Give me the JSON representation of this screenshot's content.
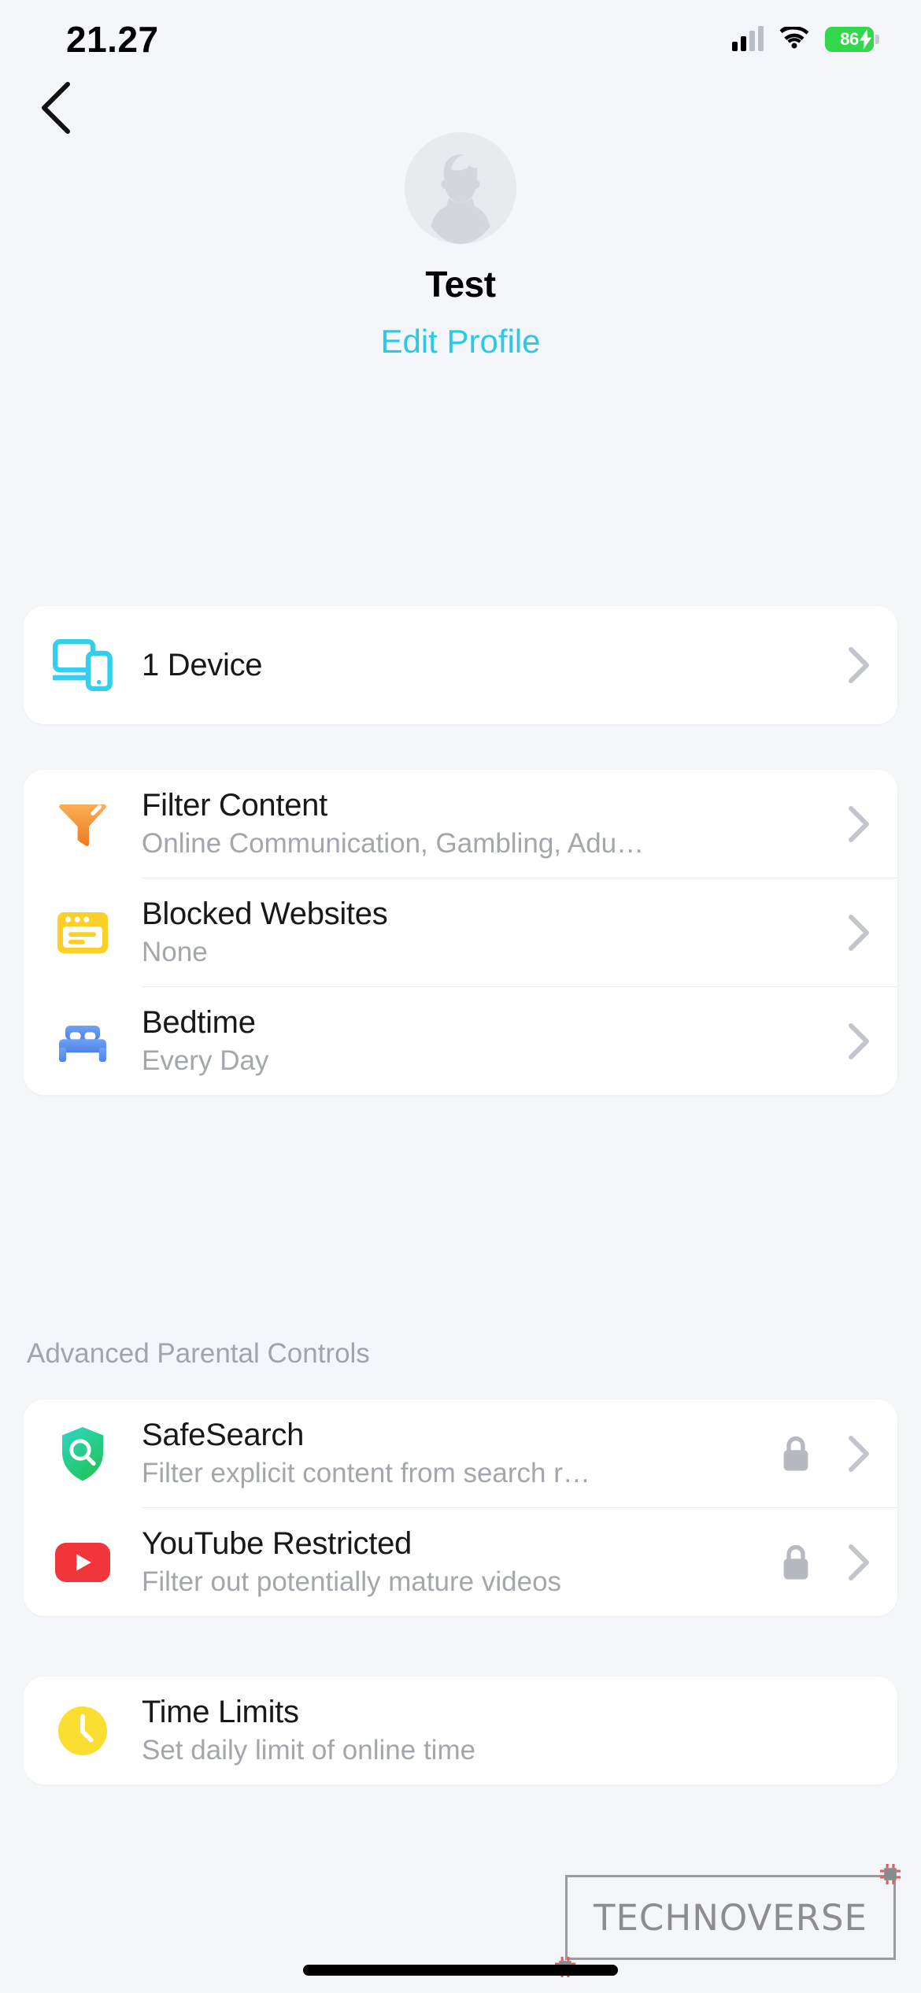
{
  "status_bar": {
    "time": "21.27",
    "battery_percent": "86",
    "battery_color": "#32D74B",
    "signal_icon": "cellular-signal-icon",
    "wifi_icon": "wifi-icon",
    "charging_icon": "charging-bolt-icon"
  },
  "nav": {
    "back_icon": "chevron-left-icon"
  },
  "profile": {
    "avatar_icon": "person-placeholder-avatar",
    "name": "Test",
    "edit_label": "Edit Profile",
    "accent_color": "#2EC8E6"
  },
  "device_card": {
    "icon": "devices-icon",
    "icon_color": "#35CFEE",
    "label": "1 Device",
    "chevron": "chevron-right-icon"
  },
  "filters_card": {
    "items": [
      {
        "icon": "funnel-filter-icon",
        "icon_color": "#F59331",
        "title": "Filter Content",
        "subtitle": "Online Communication, Gambling, Adu…"
      },
      {
        "icon": "browser-window-icon",
        "icon_color": "#FAD029",
        "title": "Blocked Websites",
        "subtitle": "None"
      },
      {
        "icon": "bed-icon",
        "icon_color": "#5B8FEF",
        "title": "Bedtime",
        "subtitle": "Every Day"
      }
    ]
  },
  "advanced_section": {
    "header": "Advanced Parental Controls",
    "items": [
      {
        "icon": "shield-search-icon",
        "icon_color": "#25D0A5",
        "title": "SafeSearch",
        "subtitle": "Filter explicit content from search r…",
        "locked": true,
        "lock_icon": "lock-icon"
      },
      {
        "icon": "youtube-icon",
        "icon_color": "#F0353B",
        "title": "YouTube Restricted",
        "subtitle": "Filter out potentially mature videos",
        "locked": true,
        "lock_icon": "lock-icon"
      }
    ]
  },
  "time_card": {
    "items": [
      {
        "icon": "clock-icon",
        "icon_color": "#FBDE32",
        "title": "Time Limits",
        "subtitle": "Set daily limit of online time"
      }
    ]
  },
  "watermark": {
    "text": "TECHNOVERSE"
  }
}
